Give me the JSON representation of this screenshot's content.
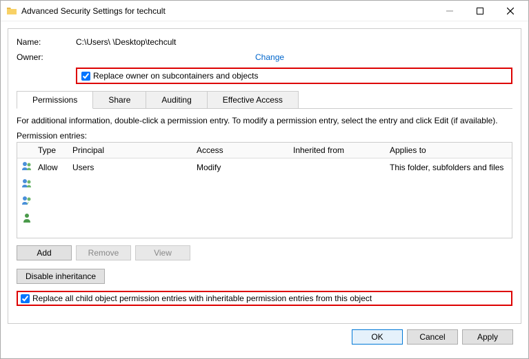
{
  "window": {
    "title": "Advanced Security Settings for techcult"
  },
  "fields": {
    "name_label": "Name:",
    "name_value": "C:\\Users\\                                  \\Desktop\\techcult",
    "owner_label": "Owner:",
    "change_link": "Change",
    "replace_owner_label": "Replace owner on subcontainers and objects"
  },
  "tabs": {
    "permissions": "Permissions",
    "share": "Share",
    "auditing": "Auditing",
    "effective": "Effective Access"
  },
  "info": "For additional information, double-click a permission entry. To modify a permission entry, select the entry and click Edit (if available).",
  "entries_label": "Permission entries:",
  "table_headers": {
    "type": "Type",
    "principal": "Principal",
    "access": "Access",
    "inherited": "Inherited from",
    "applies": "Applies to"
  },
  "rows": [
    {
      "type": "Allow",
      "principal": "Users",
      "access": "Modify",
      "inherited": "",
      "applies": "This folder, subfolders and files"
    },
    {
      "type": "",
      "principal": "",
      "access": "",
      "inherited": "",
      "applies": ""
    },
    {
      "type": "",
      "principal": "",
      "access": "",
      "inherited": "",
      "applies": ""
    },
    {
      "type": "",
      "principal": "",
      "access": "",
      "inherited": "",
      "applies": ""
    }
  ],
  "buttons": {
    "add": "Add",
    "remove": "Remove",
    "view": "View",
    "disable_inheritance": "Disable inheritance",
    "ok": "OK",
    "cancel": "Cancel",
    "apply": "Apply"
  },
  "replace_children_label": "Replace all child object permission entries with inheritable permission entries from this object"
}
